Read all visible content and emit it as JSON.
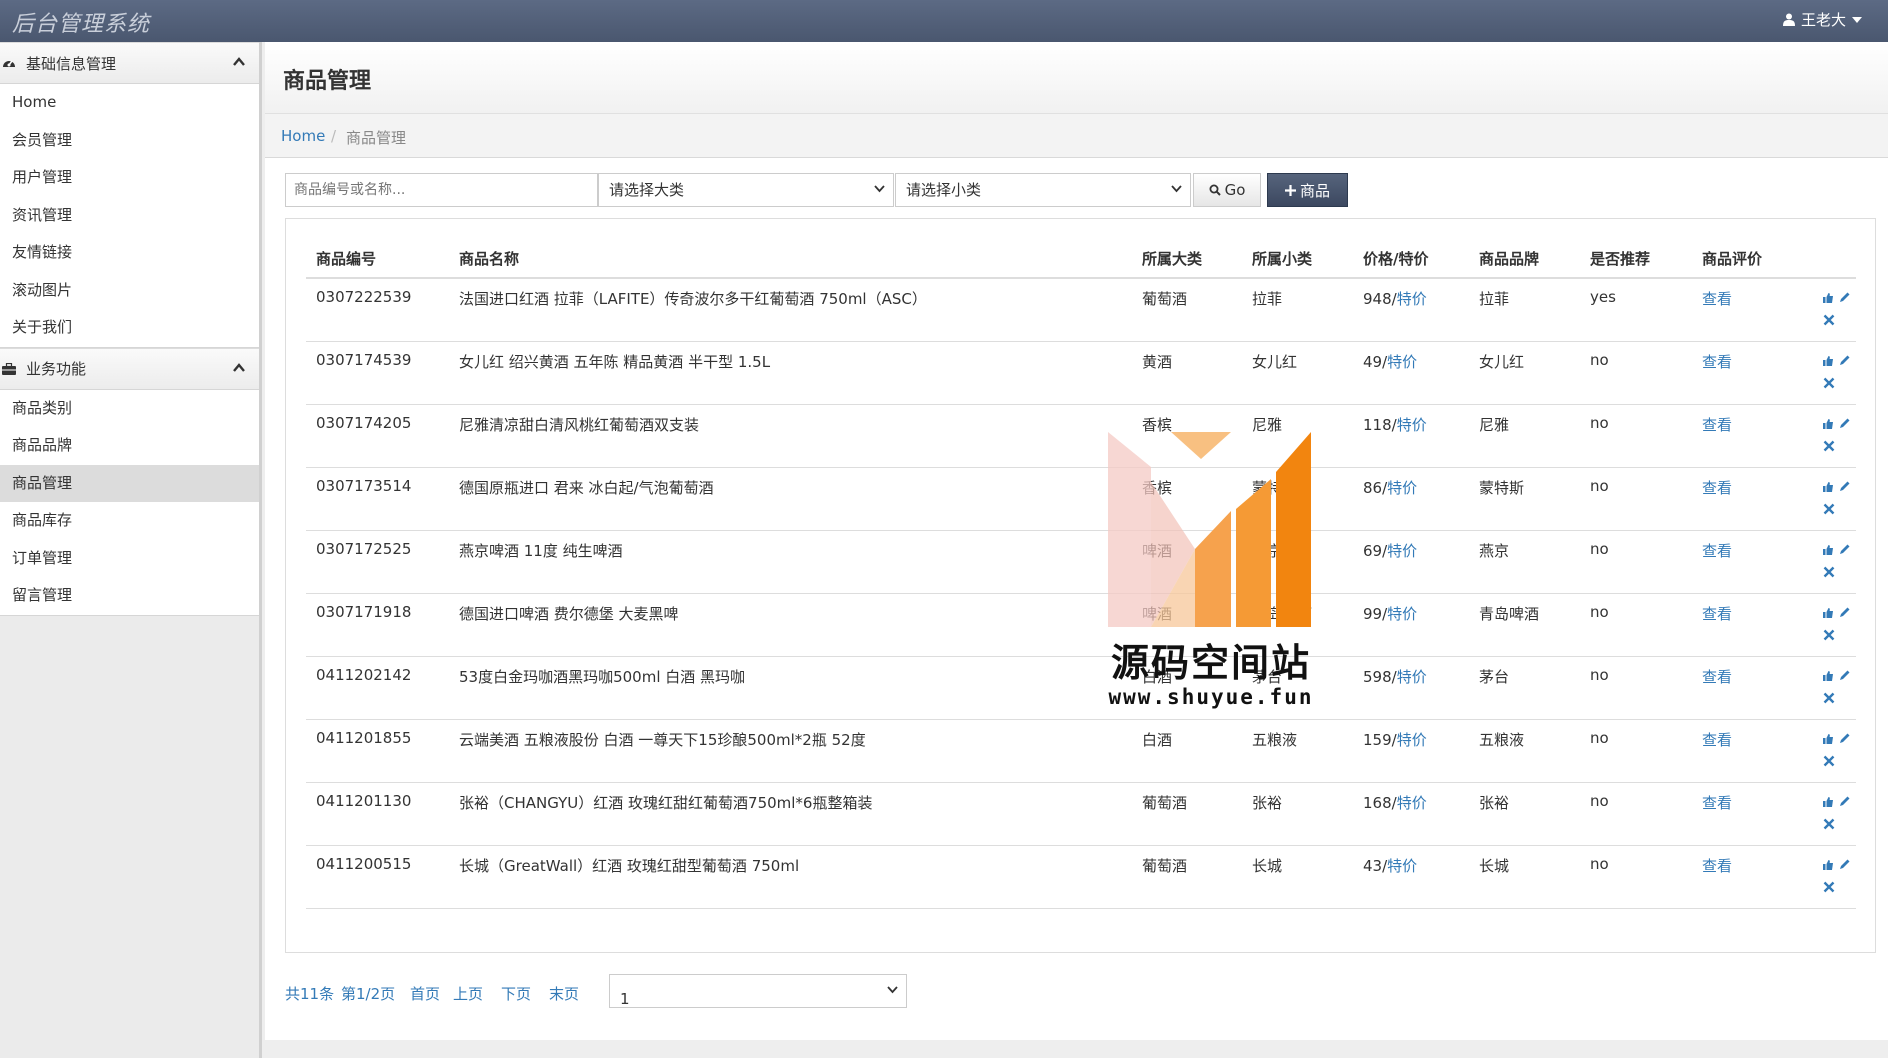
{
  "app": {
    "title": "后台管理系统"
  },
  "user": {
    "name": "王老大"
  },
  "sidebar": {
    "groups": [
      {
        "label": "基础信息管理",
        "items": [
          "Home",
          "会员管理",
          "用户管理",
          "资讯管理",
          "友情链接",
          "滚动图片",
          "关于我们"
        ]
      },
      {
        "label": "业务功能",
        "items": [
          "商品类别",
          "商品品牌",
          "商品管理",
          "商品库存",
          "订单管理",
          "留言管理"
        ]
      }
    ],
    "active": "商品管理"
  },
  "page": {
    "title": "商品管理"
  },
  "breadcrumb": {
    "home": "Home",
    "separator": "/",
    "current": "商品管理"
  },
  "toolbar": {
    "search_placeholder": "商品编号或名称...",
    "category_select": "请选择大类",
    "subcategory_select": "请选择小类",
    "go_label": "Go",
    "add_label": "商品"
  },
  "table": {
    "headers": [
      "商品编号",
      "商品名称",
      "所属大类",
      "所属小类",
      "价格/特价",
      "商品品牌",
      "是否推荐",
      "商品评价"
    ],
    "special_label": "特价",
    "view_label": "查看",
    "rows": [
      {
        "code": "0307222539",
        "name": "法国进口红酒 拉菲（LAFITE）传奇波尔多干红葡萄酒 750ml（ASC）",
        "category": "葡萄酒",
        "subcategory": "拉菲",
        "price": "948/",
        "brand": "拉菲",
        "recommended": "yes"
      },
      {
        "code": "0307174539",
        "name": "女儿红 绍兴黄酒 五年陈 精品黄酒 半干型 1.5L",
        "category": "黄酒",
        "subcategory": "女儿红",
        "price": "49/",
        "brand": "女儿红",
        "recommended": "no"
      },
      {
        "code": "0307174205",
        "name": "尼雅清凉甜白清风桃红葡萄酒双支装",
        "category": "香槟",
        "subcategory": "尼雅",
        "price": "118/",
        "brand": "尼雅",
        "recommended": "no"
      },
      {
        "code": "0307173514",
        "name": "德国原瓶进口 君来 冰白起/气泡葡萄酒",
        "category": "香槟",
        "subcategory": "蒙特斯",
        "price": "86/",
        "brand": "蒙特斯",
        "recommended": "no"
      },
      {
        "code": "0307172525",
        "name": "燕京啤酒 11度 纯生啤酒",
        "category": "啤酒",
        "subcategory": "燕京",
        "price": "69/",
        "brand": "燕京",
        "recommended": "no"
      },
      {
        "code": "0307171918",
        "name": "德国进口啤酒 费尔德堡 大麦黑啤",
        "category": "啤酒",
        "subcategory": "青岛啤酒",
        "price": "99/",
        "brand": "青岛啤酒",
        "recommended": "no"
      },
      {
        "code": "0411202142",
        "name": "53度白金玛咖酒黑玛咖500ml 白酒 黑玛咖",
        "category": "白酒",
        "subcategory": "茅台",
        "price": "598/",
        "brand": "茅台",
        "recommended": "no"
      },
      {
        "code": "0411201855",
        "name": "云端美酒 五粮液股份 白酒 一尊天下15珍酿500ml*2瓶 52度",
        "category": "白酒",
        "subcategory": "五粮液",
        "price": "159/",
        "brand": "五粮液",
        "recommended": "no"
      },
      {
        "code": "0411201130",
        "name": "张裕（CHANGYU）红酒 玫瑰红甜红葡萄酒750ml*6瓶整箱装",
        "category": "葡萄酒",
        "subcategory": "张裕",
        "price": "168/",
        "brand": "张裕",
        "recommended": "no"
      },
      {
        "code": "0411200515",
        "name": "长城（GreatWall）红酒 玫瑰红甜型葡萄酒 750ml",
        "category": "葡萄酒",
        "subcategory": "长城",
        "price": "43/",
        "brand": "长城",
        "recommended": "no"
      }
    ]
  },
  "watermark": {
    "text": "源码空间站",
    "url": "www.shuyue.fun"
  },
  "pager": {
    "total": "共11条",
    "page_info": "第1/2页",
    "first": "首页",
    "prev": "上页",
    "next": "下页",
    "last": "末页",
    "page_select": "1"
  },
  "colors": {
    "topbar": "#4f5c75",
    "link": "#337ab7",
    "watermark_orange": "#f39a2b"
  }
}
